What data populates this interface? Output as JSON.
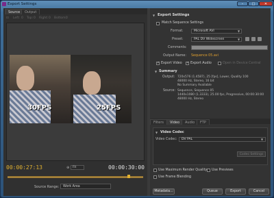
{
  "window": {
    "title": "Export Settings",
    "minimize": "–",
    "maximize": "□",
    "close": "✕"
  },
  "left": {
    "tabs": [
      "Source",
      "Output"
    ],
    "crop": {
      "left": "Left:",
      "top": "Top:",
      "right": "Right:",
      "bottom": "Bottom:",
      "zero": "0"
    },
    "overlay_left": "30FPS",
    "overlay_right": "25FPS",
    "timecode_in": "00:00:27:13",
    "timecode_out": "00:00:30:00",
    "fit_label": "Fit",
    "source_range_label": "Source Range:",
    "source_range_value": "Work Area"
  },
  "right": {
    "export_settings_title": "Export Settings",
    "match_sequence": "Match Sequence Settings",
    "format_label": "Format:",
    "format_value": "Microsoft AVI",
    "preset_label": "Preset:",
    "preset_value": "PAL DV Widescreen",
    "comments_label": "Comments:",
    "comments_value": "",
    "output_name_label": "Output Name:",
    "output_name_value": "Sequence 05.avi",
    "export_video": "Export Video",
    "export_audio": "Export Audio",
    "open_device_central": "Open in Device Central",
    "summary_title": "Summary",
    "summary_output_label": "Output:",
    "summary_output_lines": [
      "720x576 (1.4587), 25 [fps], Lower, Quality 100",
      "48000 Hz, Stereo, 16 bit",
      "No Summary Available"
    ],
    "summary_source_label": "Source:",
    "summary_source_lines": [
      "Sequence, Sequence 05",
      "1440x1080 (1.3333), 25.00 fps, Progressive, 00:00:30:00",
      "48000 Hz, Stereo"
    ],
    "tabs": [
      "Filters",
      "Video",
      "Audio",
      "FTP"
    ],
    "video_codec_title": "Video Codec",
    "video_codec_label": "Video Codec:",
    "video_codec_value": "DV PAL",
    "codec_settings_button": "Codec Settings",
    "use_max_render": "Use Maximum Render Quality",
    "use_previews": "Use Previews",
    "use_frame_blending": "Use Frame Blending",
    "buttons": {
      "metadata": "Metadata...",
      "queue": "Queue",
      "export": "Export",
      "cancel": "Cancel"
    }
  }
}
